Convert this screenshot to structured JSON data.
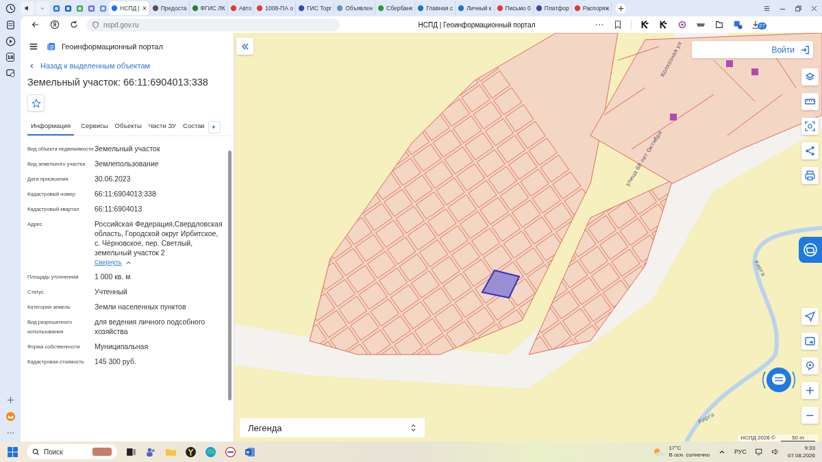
{
  "browser": {
    "sidebar_badge": "18",
    "download_badge": "27",
    "tabs": [
      {
        "title": "НСПД |",
        "selected": true
      },
      {
        "title": "Предоста",
        "selected": false
      },
      {
        "title": "ФГИС ЛК",
        "selected": false
      },
      {
        "title": "Авто",
        "selected": false
      },
      {
        "title": "1008-ПА о",
        "selected": false
      },
      {
        "title": "ГИС Торг",
        "selected": false
      },
      {
        "title": "Объявлен",
        "selected": false
      },
      {
        "title": "Сбербанк",
        "selected": false
      },
      {
        "title": "Главная с",
        "selected": false
      },
      {
        "title": "Личный к",
        "selected": false
      },
      {
        "title": "Письмо 0",
        "selected": false
      },
      {
        "title": "Платфор",
        "selected": false
      },
      {
        "title": "Распоряж",
        "selected": false
      }
    ],
    "address": "nspd.gov.ru",
    "page_title": "НСПД | Геоинформационный портал"
  },
  "panel": {
    "app_title": "Геоинформационный портал",
    "back_link": "Назад к выделенным объектам",
    "heading": "Земельный участок: 66:11:6904013:338",
    "tabs": [
      {
        "label": "Информация",
        "selected": true
      },
      {
        "label": "Сервисы",
        "selected": false
      },
      {
        "label": "Объекты",
        "selected": false
      },
      {
        "label": "Части ЗУ",
        "selected": false
      },
      {
        "label": "Состав",
        "selected": false
      }
    ],
    "fields": [
      {
        "label": "Вид объекта недвижимости",
        "value": "Земельный участок"
      },
      {
        "label": "Вид земельного участка",
        "value": "Землепользование"
      },
      {
        "label": "Дата присвоения",
        "value": "30.06.2023"
      },
      {
        "label": "Кадастровый номер",
        "value": "66:11:6904013:338"
      },
      {
        "label": "Кадастровый квартал",
        "value": "66:11:6904013"
      },
      {
        "label": "Адрес",
        "value": "Российская Федерация,Свердловская область, Городской округ Ирбитское, с. Чёрновское, пер. Светлый, земельный участок 2",
        "link": "Свернуть"
      },
      {
        "label": "Площадь уточненная",
        "value": "1 000 кв. м"
      },
      {
        "label": "Статус",
        "value": "Учтенный"
      },
      {
        "label": "Категория земель",
        "value": "Земли населенных пунктов"
      },
      {
        "label": "Вид разрешенного использования",
        "value": "для ведения личного подсобного хозяйства"
      },
      {
        "label": "Форма собственности",
        "value": "Муниципальная"
      },
      {
        "label": "Кадастровая стоимость",
        "value": "145 300 руб."
      }
    ]
  },
  "map": {
    "login": "Войти",
    "legend": "Легенда",
    "copyright": "НСПД 2026 ©",
    "scale": "50 m",
    "labels": [
      {
        "text": "улица 68 лет Октября",
        "kind": "street"
      },
      {
        "text": "Колхозная ул",
        "kind": "street"
      },
      {
        "text": "Кирга",
        "kind": "river"
      },
      {
        "text": "Кирга",
        "kind": "river"
      }
    ]
  },
  "taskbar": {
    "search": "Поиск",
    "temperature": "17°C",
    "weather": "В осн. солнечно",
    "language": "РУС",
    "time": "9:33",
    "date": "07.08.2026"
  }
}
